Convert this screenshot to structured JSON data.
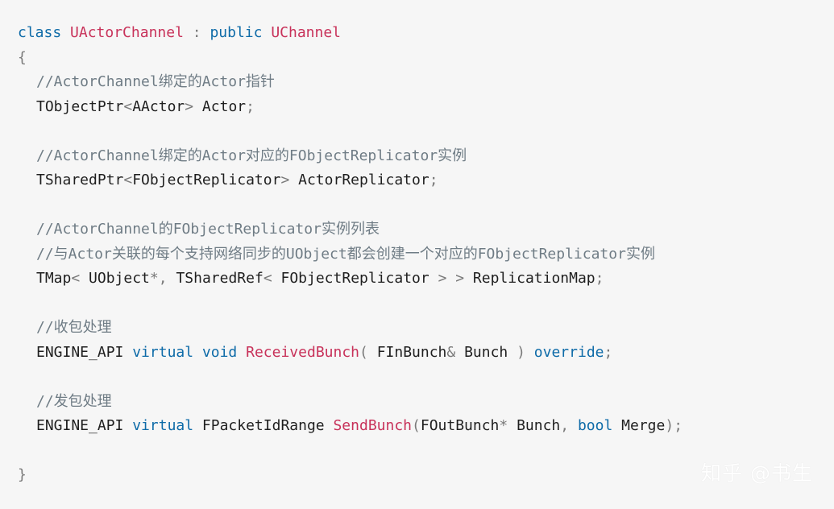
{
  "code": {
    "l1": {
      "kw_class": "class",
      "type_name": "UActorChannel",
      "colon": " : ",
      "kw_public": "public",
      "base_type": "UChannel"
    },
    "l2": {
      "brace_open": "{"
    },
    "l3": {
      "comment": "//ActorChannel绑定的Actor指针"
    },
    "l4": {
      "t1": "TObjectPtr",
      "lt": "<",
      "t2": "AActor",
      "gt": ">",
      "var": " Actor",
      "semi": ";"
    },
    "l6": {
      "comment": "//ActorChannel绑定的Actor对应的FObjectReplicator实例"
    },
    "l7": {
      "t1": "TSharedPtr",
      "lt": "<",
      "t2": "FObjectReplicator",
      "gt": ">",
      "var": " ActorReplicator",
      "semi": ";"
    },
    "l9": {
      "comment": "//ActorChannel的FObjectReplicator实例列表"
    },
    "l10": {
      "comment": "//与Actor关联的每个支持网络同步的UObject都会创建一个对应的FObjectReplicator实例"
    },
    "l11": {
      "t1": "TMap",
      "lt1": "<",
      "t2": " UObject",
      "star": "*",
      "comma": ", ",
      "t3": "TSharedRef",
      "lt2": "<",
      "t4": " FObjectReplicator ",
      "gt1": ">",
      "sp": " ",
      "gt2": ">",
      "var": " ReplicationMap",
      "semi": ";"
    },
    "l13": {
      "comment": "//收包处理"
    },
    "l14": {
      "api": "ENGINE_API ",
      "kw_virtual": "virtual",
      "sp1": " ",
      "kw_void": "void",
      "sp2": " ",
      "fn": "ReceivedBunch",
      "paren_open": "(",
      "arg_type": " FInBunch",
      "amp": "&",
      "arg_name": " Bunch ",
      "paren_close": ")",
      "sp3": " ",
      "kw_override": "override",
      "semi": ";"
    },
    "l16": {
      "comment": "//发包处理"
    },
    "l17": {
      "api": "ENGINE_API ",
      "kw_virtual": "virtual",
      "ret": " FPacketIdRange ",
      "fn": "SendBunch",
      "paren_open": "(",
      "arg1_type": "FOutBunch",
      "star": "*",
      "arg1_name": " Bunch",
      "comma": ",",
      "sp": " ",
      "kw_bool": "bool",
      "arg2_name": " Merge",
      "paren_close": ")",
      "semi": ";"
    },
    "l19": {
      "brace_close": "}"
    }
  },
  "watermark": "知乎 @书生"
}
